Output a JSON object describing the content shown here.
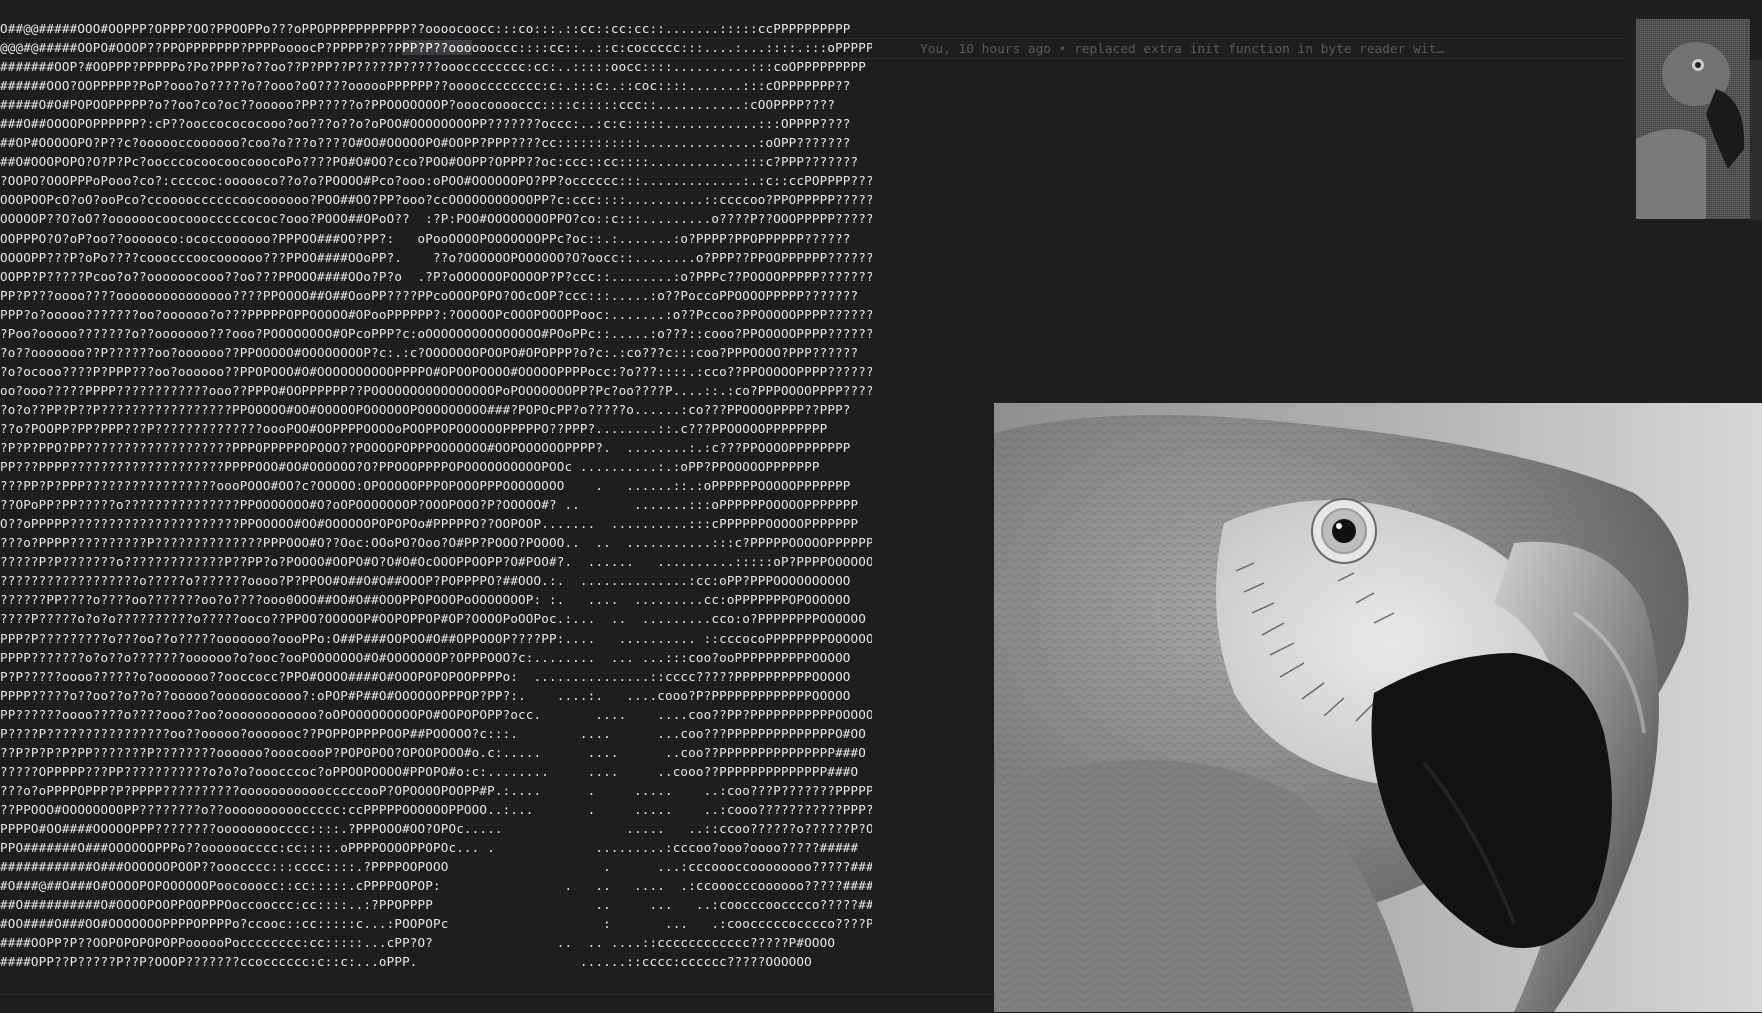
{
  "editor": {
    "blame_text": "You, 10 hours ago • replaced extra init function in byte reader wit…",
    "lines": [
      "O##@@#####OOO#OOPPP?OPPP?OO?PPOOPPo???oPPOPPPPPPPPPPP??oooocoocc:::co:::.::cc::cc:cc::.......:::::ccPPPPPPPPPP",
      "@@@#@#####OOPO#OOOP??PPOPPPPPPP?PPPPoooocP?PPPP?P??PPP?P??ooooooccc::::cc::..::c:coccccc:::....:...::::.:::oPPPPPPPPPP",
      "#######OOP?#OOPPP?PPPPPo?Po?PPP?o??oo??P?PP??P?????P?????ooocccccccc:cc:..:::::oocc::::..........:::coOPPPPPPPPP",
      "######OOO?OOPPPPP?PoP?ooo?o?????o??ooo?oO????oooooPPPPPP??oooocccccccc:c:.:::c:.::coc::::.......:::cOPPPPPPP??",
      "#####O#O#POPOOPPPPP?o??oo?co?oc??ooooo?PP?????o?PPOOOOOOOP?ooocooooccc::::c:::::ccc::...........:cOOPPPP????",
      "###O##OOOOPOPPPPPP?:cP??ooccocococooo?oo???o??o?oPOO#OOOOOOOOPP???????occc:..:c:c:::::............:::OPPPP????",
      "##OP#OOOOOPO?P??c?oooooccoooooo?coo?o???o????O#OO#OOOOOPO#OOPP?PPP????cc:::::::::::...............:oOPP???????",
      "##O#OOOPOPO?O?P?Pc?oocccocoocoocooocoPo????PO#O#OO?cco?POO#OOPP?OPPP??oc:ccc::cc::::............:::c?PPP???????",
      "?OOPO?OOOPPPoPooo?co?:ccccoc:oooooco??o?o?POOOO#Pco?ooo:oPOO#OOOOOOPO?PP?occcccc:::.............:.:c::ccPOPPPP?????",
      "OOOPOOPcO?oO?ooPco?ccooooccccccoocoooooo?POO##OO?PP?ooo?ccOOOOOOOOOOOPP?c:ccc::::..........::ccccoo?PPOPPPPP?????",
      "OOOOOP??O?oO??oooooocoocooocccccococ?ooo?POOO##OPoO??  :?P:POO#OOOOOOOOPPO?co::c:::.........o????P??OOOPPPPP?????",
      "OOPPPO?O?oP?oo??oooooco:ococcoooooo?PPPOO###OO?PP?:   oPooOOOOPOOOOOOOPPc?oc::.:.......:o?PPPP?PPOPPPPPP??????",
      "OOOOPP???P?oPo????cooocccoocoooooo???PPOO####OOoPP?.    ??o?OOOOOOPOOOOOO?O?oocc::........o?PPP??PPOOPPPPPP???????",
      "OOPP?P?????Pcoo?o??oooooocooo??oo???PPOOO####OOo?P?o  .?P?oOOOOOOPOOOOP?P?ccc::........:o?PPPc??POOOOPPPPP???????",
      "PP?P???oooo????ooooooooooooooo????PPOOOO##O##OooPP????PPcoOOOPOPO?OOcOOP?ccc:::.....:o??PoccoPPOOOOPPPPP???????",
      "PPP?o?ooooo???????oo?oooooo?o???PPPPPOPPOOOOO#OPooPPPPPP?:?OOOOOPcOOOPOOOPPooc:.......:o??Pccoo?PPOOOOOPPPP???????",
      "?Poo?ooooo???????o??ooooooo???ooo?POOOOOOOO#OPcoPPP?c:oOOOOOOOOOOOOOOO#POoPPc::.....:o???::cooo?PPOOOOOPPPP??????",
      "?o??ooooooo??P??????oo?oooooo??PPOOOOO#OOOOOOOOP?c:.:c?OOOOOOOPOOPO#OPOPPP?o?c:.:co???c:::coo?PPPOOOO?PPP??????",
      "?o?ocooo????P?PPP???oo?oooooo??PPOPOOO#O#OOOOOOOOOOPPPPO#OPOOPOOOO#OOOOOPPPPocc:?o???::::.:cco??PPOOOOOPPPP??????",
      "oo?ooo?????PPPP????????????ooo??PPPO#OOPPPPPP??POOOOOOOOOOOOOOOOPoPOOOOOOOPP?Pc?oo????P....::.:co?PPPOOOOPPPP?????",
      "?o?o??PP?P??P?????????????????PPOOOOO#OO#OOOOOPOOOOOOPOOOOOOOOO###?POPOcPP?o?????o......:co???PPOOOOPPPP??PPP?",
      "??o?POOPP?PP?PPP???P??????????????oooPOO#OOPPPPOOOOoPOOPPOPOOOOOOPPPPPO??PPP?........::.c???PPOOOOOPPPPPPPP",
      "?P?P?PPO?PP???????????????????PPPOPPPPPOPOOO??POOOOPOPPPOOOOOOO#OOPOOOOOOPPPP?.  ........:.:c???PPOOOOPPPPPPPP",
      "PP???PPPP????????????????????PPPPOOO#OO#OOOOOO?O?PPOOOPPPPOPOOOOOOOOOOPOOc ..........:.:oPP?PPOOOOOPPPPPPP",
      "???PP?P?PPP?????????????????oooPOOO#OO?c?OOOOO:OPOOOOOPPPOPOOOPPPOOOOOOOO    .   ......::.:oPPPPPPOOOOOPPPPPPP",
      "??OPoPP?PP?????o???????????????PPOOOOOOO#O?oOPOOOOOOOP?OOOPOOO?P?OOOOO#? ..       .......:::oPPPPPPOOOOOPPPPPPP",
      "O??oPPPPP??????????????????????PPOOOOO#OO#OOOOOOPOPOPOo#PPPPPO??OOPOOP.......  ..........:::cPPPPPPOOOOOPPPPPPP",
      "???o?PPPP??????????P??????????????PPPOOO#O??Ooc:OOoPO?Ooo?O#PP?POOO?POOOO..  ..  ...........:::c?PPPPPOOOOOPPPPPP",
      "?????P?P???????o?????????????P??PP?o?POOOO#OOPO#O?O#O#OcOOOPPOOPP?O#POO#?.  ......   ..........:::::oP?PPPPOOOOOOOOOO",
      "??????????????????o?????o???????oooo?P?PPOO#O##O#O##OOOP?POPPPPO?##OOO.:.  ..............:cc:oPP?PPPOOOOOOOOOO",
      "??????PP????o????oo???????oo?o????ooo0OOO##OO#O##OOOPPOPOOOPoOOOOOOOP: :.   ....  .........cc:oPPPPPPPOPOOOOOO",
      "????P?????o?o?o??????????o?????ooco??PPOO?OOOOOP#OOPOPPOP#OP?OOOOPoOOPoc.:...  ..  .........cco:o?PPPPPPPPOOOOOO",
      "PPP?P?????????o???oo??o?????ooooooo?oooPPo:O##P###OOPOO#O##OPPOOOP????PP:....   .......... ::cccocoPPPPPPPPOOOOOO",
      "PPPP???????o?o??o???????oooooo?o?ooc?ooPOOOOOOO#O#OOOOOOOP?OPPPOOO?c:........  ... ...:::coo?ooPPPPPPPPPPOOOOO",
      "P?P?????oooo??????o?ooooooo??ooccocc?PPO#OOOO####O#OOOPOPOPOOPPPPo:  ...............::cccc?????PPPPPPPPPPOOOOO",
      "PPPP?????o??oo??o??o??ooooo?oooooocoooo?:oPOP#P##O#OOOOOOPPPOP?PP?:.    ....:.   ....cooo?P?PPPPPPPPPPPPPOOOOO",
      "PP??????oooo????o????ooo??oo?oooooooooooo?oOPOOOOOOOOOPO#OOPOPOPP?occ.       ....    ....coo??PP?PPPPPPPPPPPOOOOO",
      "P????P????????????????oo??ooooo?ooooooc??POPPOPPPPOOP##POOOOO?c:::.        ....      ...coo???PPPPPPPPPPPPPPO#OO",
      "??P?P?P?P?PP???????P????????oooooo?ooocoooP?POPOPOO?OPOOPOOO#o.c:.....      ....      ..coo??PPPPPPPPPPPPPPP###O",
      "?????OPPPPP???PP???????????o?o?o?ooocccoc?oPPOOPOOOO#PPOPO#o:c:........     ....     ..cooo??PPPPPPPPPPPPPP###O",
      "???o?oPPPPOPPP?P?PPPP??????????ooooooooooocccccooP?OPOOOOPOOPP#P.:....      .     .....    ..:coo???P???????PPPPPO###",
      "??PPOOO#OOOOOOOOPP????????o??ooooooooooccccc:ccPPPPPOOOOOOPPOOO..:...       .     .....    ..:cooo???????????PPP?O###",
      "PPPPO#OO####OOOOOPPP????????oooooooocccc::::.?PPPOOO#OO?OPOc.....                .....   ..::ccoo??????o??????P?O###",
      "PPO#######O###OOOOOOPPPo??oooooocccc:cc::::.oPPPPOOOOPPOPOc... .             .........:cccoo?ooo?oooo?????#####",
      "############O###OOOOOOPOOP??ooocccc:::cccc::::.?PPPPOOPOOO                    .      ...:cccoooccoooooooo?????#####",
      "#O###@##O###O#OOOOPOPOOOOOOPoocooocc::cc:::::.cPPPPOOPOP:                .   ..   ....  .:ccooocccoooooo?????#####",
      "##O##########O#OOOOPOOPPOOPPPOoccooccc:cc::::..:?PPOPPPP                     ..     ...   ..:coocccoocccco?????#####",
      "#OO####O###OO#OOOOOOOPPPPOPPPPo?ccooc::cc:::::c...:POOPOPc                    :       ...   .:coocccccocccco????P#####",
      "####OOPP?P??OOPOPOPOPOPPoooooPocccccccc:cc:::::...cPP?O?                ..  .. ....::cccccccccccc?????P#OOOO",
      "####OPP??P?????P??P?OOOP???????ccocccccc:c::c:...oPPP.                     ......::cccc:cccccc?????OOOOOO"
    ]
  },
  "colors": {
    "background": "#1e1e1e",
    "text": "#e8e8e8",
    "blame": "#5a5a5a"
  },
  "icons": {
    "minimap": "minimap-preview",
    "photo": "parrot-photo"
  }
}
